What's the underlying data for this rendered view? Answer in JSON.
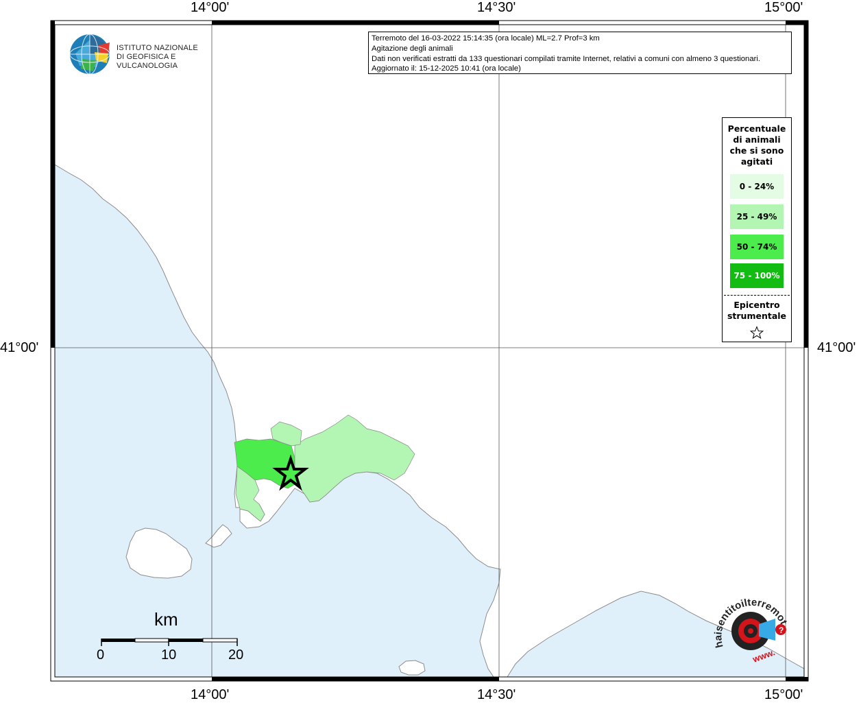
{
  "info": {
    "line1": "Terremoto del 16-03-2022 15:14:35 (ora locale) ML=2.7 Prof=3 km",
    "line2": "Agitazione degli animali",
    "line3": "Dati non verificati estratti da 133 questionari compilati tramite Internet, relativi a comuni con almeno 3 questionari.",
    "line4": "Aggiornato il: 15-12-2025 10:41 (ora locale)"
  },
  "logo": {
    "line1": "ISTITUTO NAZIONALE",
    "line2": "DI GEOFISICA E VULCANOLOGIA"
  },
  "axes": {
    "top": [
      "14°00'",
      "14°30'",
      "15°00'"
    ],
    "bottom": [
      "14°00'",
      "14°30'",
      "15°00'"
    ],
    "left": "41°00'",
    "right": "41°00'"
  },
  "legend": {
    "title": "Percentuale di animali che si sono agitati",
    "classes": [
      {
        "label": "0 - 24%",
        "color": "#e4fbe4",
        "text_color": "#000000"
      },
      {
        "label": "25 - 49%",
        "color": "#b3f5b3",
        "text_color": "#000000"
      },
      {
        "label": "50 - 74%",
        "color": "#4cec4c",
        "text_color": "#000000"
      },
      {
        "label": "75 - 100%",
        "color": "#12bc12",
        "text_color": "#ffffff"
      }
    ],
    "epicenter_label": "Epicentro strumentale",
    "epicenter_icon": "star-outline-icon"
  },
  "scale": {
    "title": "km",
    "ticks": [
      "0",
      "10",
      "20"
    ]
  },
  "brand": {
    "name": "haisentitoilterremoto.it",
    "prefix": "www.",
    "accent": "#d3141b"
  },
  "colors": {
    "sea": "#dff0fb",
    "land": "#ffffff",
    "borders": "#a8a8a8"
  }
}
